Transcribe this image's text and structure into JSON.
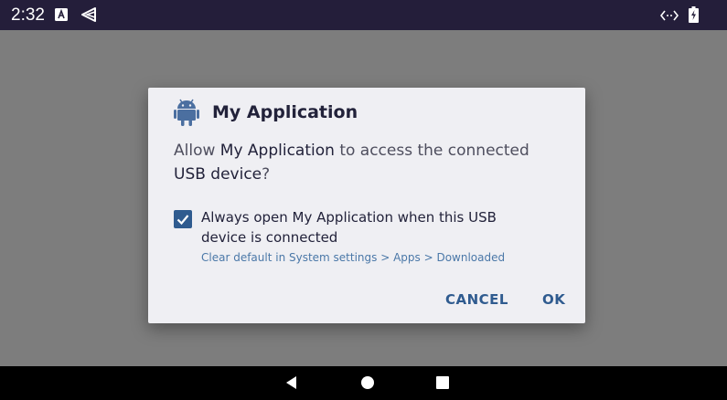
{
  "status_bar": {
    "time": "2:32",
    "icons": [
      "a-icon",
      "triangle-signal-icon",
      "code-icon",
      "battery-charging-icon"
    ]
  },
  "dialog": {
    "app_icon": "android-icon",
    "title": "My Application",
    "message": {
      "part1": "Allow ",
      "app_name": "My Application",
      "part2": " to access the connected ",
      "device": "USB device",
      "part3": "?"
    },
    "checkbox": {
      "checked": true,
      "label": "Always open My Application when this USB device is connected"
    },
    "hint": "Clear default in System settings > Apps > Downloaded",
    "buttons": {
      "cancel": "CANCEL",
      "ok": "OK"
    }
  },
  "nav_bar": {
    "icons": [
      "back-icon",
      "home-icon",
      "recents-icon"
    ]
  },
  "colors": {
    "accent": "#2f5b8f",
    "status_bar": "#241e3a",
    "scrim": "#7d7d7d",
    "dialog_bg": "#efeff3"
  }
}
